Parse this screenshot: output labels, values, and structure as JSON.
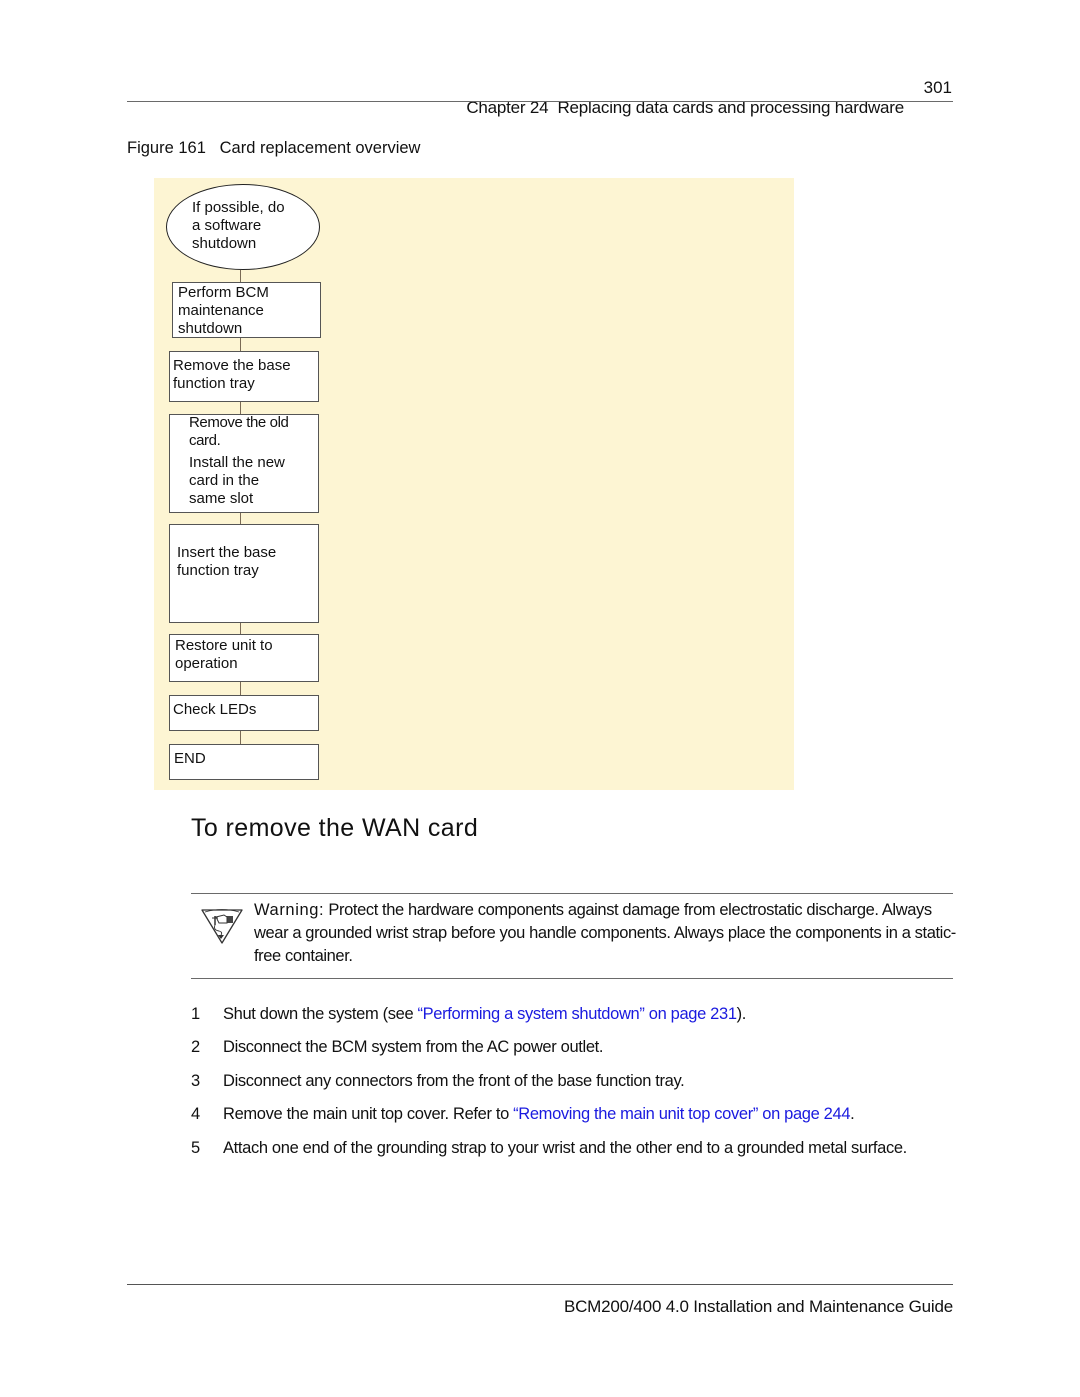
{
  "header": {
    "chapter": "Chapter 24  Replacing data cards and processing hardware",
    "page_number": "301"
  },
  "figure": {
    "caption": "Figure 161   Card replacement overview",
    "background_color": "#fdf5d3",
    "flowchart": {
      "start": "If possible, do\na software\nshutdown",
      "steps": [
        "Perform BCM\nmaintenance\nshutdown",
        "Remove the base\nfunction tray",
        "Remove the old\ncard.",
        "Install the new\ncard in the\nsame slot",
        "Insert the base\nfunction tray",
        "Restore unit to\noperation",
        "Check LEDs",
        "END"
      ]
    }
  },
  "section": {
    "title": "To remove the WAN card"
  },
  "warning": {
    "icon": "esd-warning-icon",
    "label": "Warning:",
    "text": " Protect the hardware components against damage from electrostatic discharge. Always wear a grounded wrist strap before you handle components. Always place the components in a static-free container."
  },
  "steps": [
    {
      "number": "1",
      "pre": "Shut down the system (see ",
      "link": "“Performing a system shutdown” on page 231",
      "post": ")."
    },
    {
      "number": "2",
      "pre": "Disconnect the BCM system from the AC power outlet.",
      "link": "",
      "post": ""
    },
    {
      "number": "3",
      "pre": "Disconnect any connectors from the front of the base function tray.",
      "link": "",
      "post": ""
    },
    {
      "number": "4",
      "pre": "Remove the main unit top cover. Refer to ",
      "link": "“Removing the main unit top cover” on page 244",
      "post": "."
    },
    {
      "number": "5",
      "pre": "Attach one end of the grounding strap to your wrist and the other end to a grounded metal surface.",
      "link": "",
      "post": ""
    }
  ],
  "colors": {
    "link": "#1a1adf"
  },
  "footer": {
    "guide_title": "BCM200/400 4.0 Installation and Maintenance Guide"
  }
}
